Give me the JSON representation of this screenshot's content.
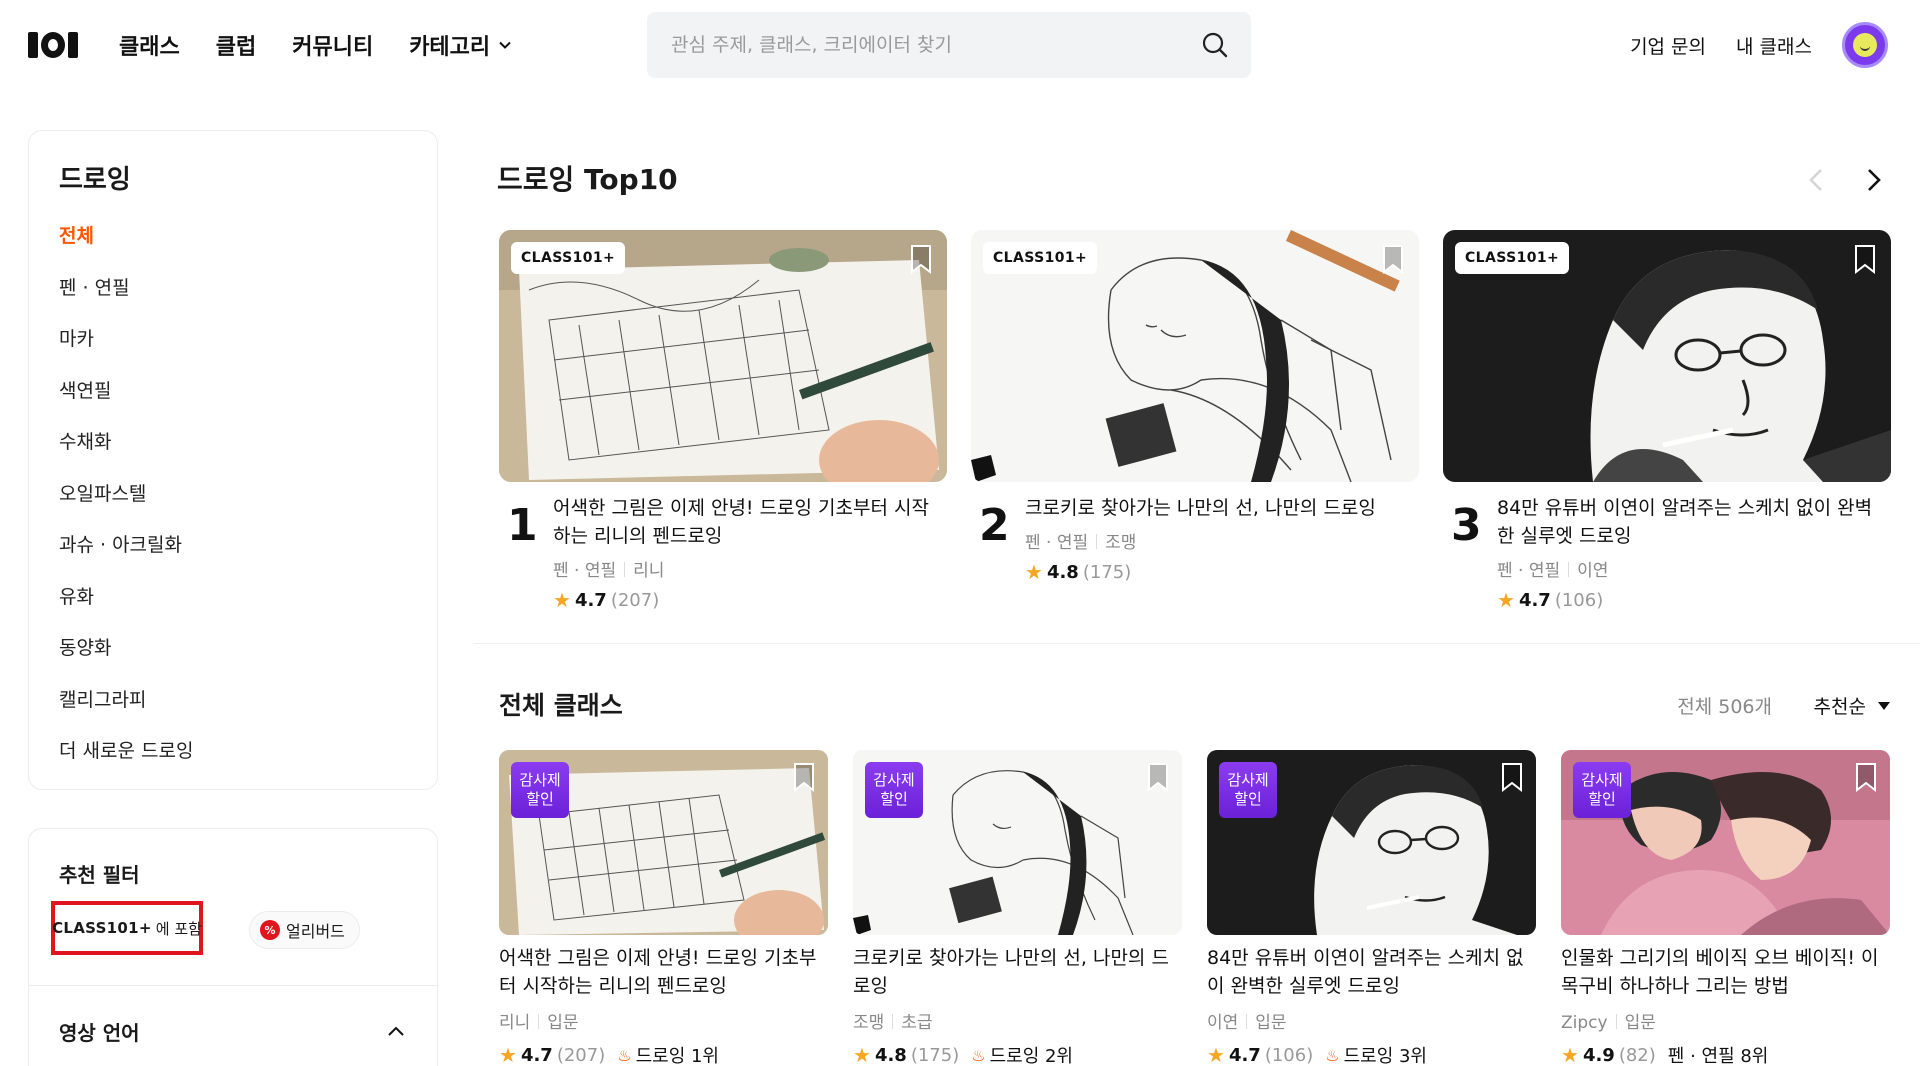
{
  "header": {
    "logo_alt": "101",
    "nav": [
      "클래스",
      "클럽",
      "커뮤니티",
      "카테고리"
    ],
    "search_placeholder": "관심 주제, 클래스, 크리에이터 찾기",
    "links": [
      "기업 문의",
      "내 클래스"
    ],
    "icons": [
      "search-icon",
      "chevron-down-icon",
      "avatar"
    ]
  },
  "sidebar": {
    "title": "드로잉",
    "categories": [
      {
        "label": "전체",
        "active": true
      },
      {
        "label": "펜 · 연필"
      },
      {
        "label": "마카"
      },
      {
        "label": "색연필"
      },
      {
        "label": "수채화"
      },
      {
        "label": "오일파스텔"
      },
      {
        "label": "과슈 · 아크릴화"
      },
      {
        "label": "유화"
      },
      {
        "label": "동양화"
      },
      {
        "label": "캘리그라피"
      },
      {
        "label": "더 새로운 드로잉"
      }
    ],
    "filter": {
      "title": "추천 필터",
      "class101_plus": "CLASS101+",
      "class101_suffix": "에 포함",
      "early_bird": "얼리버드",
      "early_icon": "%",
      "language_title": "영상 언어"
    }
  },
  "top10": {
    "title": "드로잉 Top10",
    "badge": "CLASS101+",
    "items": [
      {
        "rank": "1",
        "title": "어색한 그림은 이제 안녕! 드로잉 기초부터 시작하는 리니의 펜드로잉",
        "category": "펜 · 연필",
        "creator": "리니",
        "score": "4.7",
        "count": "(207)"
      },
      {
        "rank": "2",
        "title": "크로키로 찾아가는 나만의 선, 나만의 드로잉",
        "category": "펜 · 연필",
        "creator": "조맹",
        "score": "4.8",
        "count": "(175)"
      },
      {
        "rank": "3",
        "title": "84만 유튜버 이연이 알려주는 스케치 없이 완벽한 실루엣 드로잉",
        "category": "펜 · 연필",
        "creator": "이연",
        "score": "4.7",
        "count": "(106)"
      }
    ]
  },
  "all_classes": {
    "title": "전체 클래스",
    "total": "전체 506개",
    "sort": "추천순",
    "sale_line1": "감사제",
    "sale_line2": "할인",
    "items": [
      {
        "title": "어색한 그림은 이제 안녕! 드로잉 기초부터 시작하는 리니의 펜드로잉",
        "creator": "리니",
        "level": "입문",
        "score": "4.7",
        "count": "(207)",
        "rank": "드로잉 1위"
      },
      {
        "title": "크로키로 찾아가는 나만의 선, 나만의 드로잉",
        "creator": "조맹",
        "level": "초급",
        "score": "4.8",
        "count": "(175)",
        "rank": "드로잉 2위"
      },
      {
        "title": "84만 유튜버 이연이 알려주는 스케치 없이 완벽한 실루엣 드로잉",
        "creator": "이연",
        "level": "입문",
        "score": "4.7",
        "count": "(106)",
        "rank": "드로잉 3위"
      },
      {
        "title": "인물화 그리기의 베이직 오브 베이직! 이목구비 하나하나 그리는 방법",
        "creator": "Zipcy",
        "level": "입문",
        "score": "4.9",
        "count": "(82)",
        "rank": "펜 · 연필 8위"
      }
    ]
  },
  "colors": {
    "accent": "#ff5600",
    "sale": "#7c2ee6",
    "highlight_box": "#e0161f",
    "star": "#f5a623"
  }
}
